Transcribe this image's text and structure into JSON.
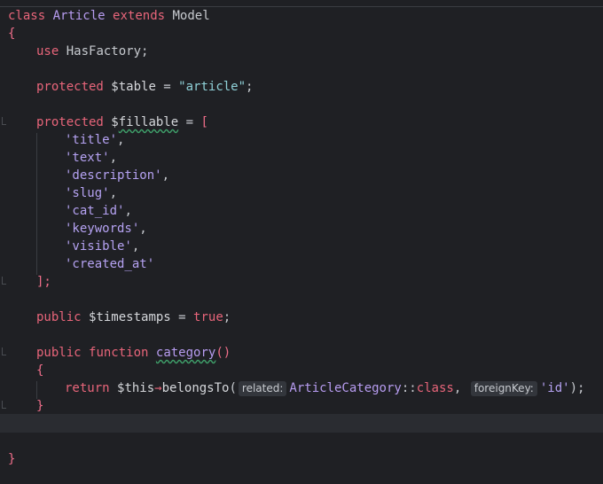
{
  "code": {
    "class_kw": "class",
    "class_name": "Article",
    "extends_kw": "extends",
    "parent": "Model",
    "open_brace": "{",
    "use_kw": "use",
    "trait": "HasFactory",
    "semicolon": ";",
    "protected_kw": "protected",
    "table_var": "$table",
    "assign": " = ",
    "table_val": "\"article\"",
    "fillable_var_prefix": "$",
    "fillable_var_word": "fillable",
    "open_bracket": "[",
    "fillable_items": [
      "'title'",
      "'text'",
      "'description'",
      "'slug'",
      "'cat_id'",
      "'keywords'",
      "'visible'",
      "'created_at'"
    ],
    "comma": ",",
    "close_bracket": "];",
    "public_kw": "public",
    "timestamps_var": "$timestamps",
    "true_kw": "true",
    "function_kw": "function",
    "method_name": "category",
    "parens": "()",
    "return_kw": "return",
    "this_var": "$this",
    "arrow": "→",
    "belongs_to": "belongsTo",
    "open_paren": "(",
    "hint_related": "related:",
    "related_class": "ArticleCategory",
    "scope": "::",
    "class_const": "class",
    "hint_foreign": "foreignKey:",
    "foreign_val": "'id'",
    "close_call": ");",
    "close_brace": "}"
  }
}
